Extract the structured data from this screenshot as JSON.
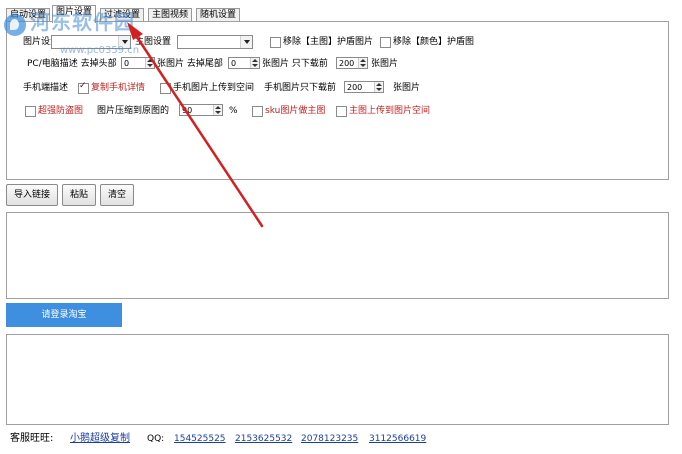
{
  "tabs": [
    "启动设置",
    "图片设置",
    "过滤设置",
    "主图视频",
    "随机设置"
  ],
  "watermark": {
    "text": "河东软件园",
    "url": "www.pc0359.cn"
  },
  "row1": {
    "image_setting_label": "图片设置",
    "image_setting_value": "",
    "main_image_label": "主图设置",
    "main_image_value": "",
    "remove_main_label": "移除【主图】护盾图片",
    "remove_color_label": "移除【颜色】护盾图"
  },
  "row2": {
    "pc_desc_label": "PC/电脑描述 去掉头部",
    "head_value": "0",
    "unit_a": "张图片 去掉尾部",
    "tail_value": "0",
    "unit_b": "张图片 只下载前",
    "download_value": "200",
    "unit_c": "张图片"
  },
  "row3": {
    "mobile_desc_label": "手机端描述",
    "copy_mobile_label": "复制手机详情",
    "upload_mobile_label": "手机图片上传到空间",
    "mobile_download_label": "手机图片只下载前",
    "mobile_download_value": "200",
    "unit": "张图片"
  },
  "row4": {
    "super_anti_label": "超强防盗图",
    "compress_label": "图片压缩到原图的",
    "compress_value": "90",
    "percent": "%",
    "sku_label": "sku图片做主图",
    "upload_main_label": "主图上传到图片空间"
  },
  "buttons": {
    "import": "导入链接",
    "paste": "粘贴",
    "clear": "清空"
  },
  "login_button": "请登录淘宝",
  "footer": {
    "service_label": "客服旺旺:",
    "service_link": "小鹅超级复制",
    "qq_label": "QQ:",
    "qq_numbers": [
      "154525525",
      "2153625532",
      "2078123235",
      "3112566619"
    ]
  },
  "colors": {
    "accent": "#3f8fe0",
    "red_label": "#c02020",
    "link": "#1a3fa0"
  }
}
